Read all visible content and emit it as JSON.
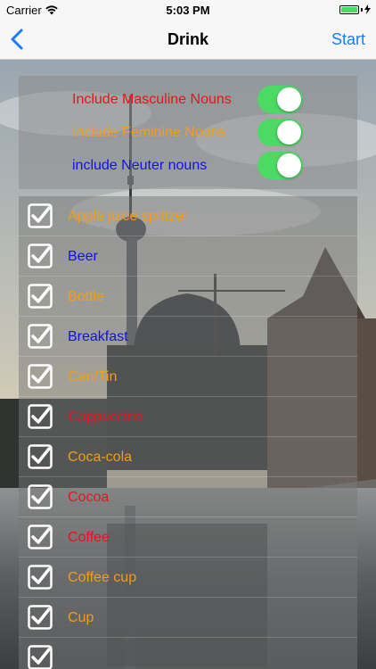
{
  "status_bar": {
    "carrier": "Carrier",
    "time": "5:03 PM",
    "battery_level": 1.0
  },
  "nav": {
    "back_icon": "chevron-left-icon",
    "title": "Drink",
    "start_label": "Start"
  },
  "toggles": [
    {
      "label": "Include Masculine Nouns",
      "color": "#e8131b",
      "on": true
    },
    {
      "label": "Include Feminine Nouns",
      "color": "#f39c1c",
      "on": true
    },
    {
      "label": "include Neuter nouns",
      "color": "#1111ee",
      "on": true
    }
  ],
  "nouns": [
    {
      "label": "Apple juice spritzer",
      "color": "#f39c1c",
      "checked": true
    },
    {
      "label": "Beer",
      "color": "#1111ee",
      "checked": true
    },
    {
      "label": "Bottle",
      "color": "#f39c1c",
      "checked": true
    },
    {
      "label": "Breakfast",
      "color": "#1111ee",
      "checked": true
    },
    {
      "label": "Can/Tin",
      "color": "#f39c1c",
      "checked": true
    },
    {
      "label": "Cappuccino",
      "color": "#e8131b",
      "checked": true
    },
    {
      "label": "Coca-cola",
      "color": "#f39c1c",
      "checked": true
    },
    {
      "label": "Cocoa",
      "color": "#e8131b",
      "checked": true
    },
    {
      "label": "Coffee",
      "color": "#e8131b",
      "checked": true
    },
    {
      "label": "Coffee cup",
      "color": "#f39c1c",
      "checked": true
    },
    {
      "label": "Cup",
      "color": "#f39c1c",
      "checked": true
    },
    {
      "label": "",
      "color": "#f39c1c",
      "checked": true
    }
  ],
  "colors": {
    "accent": "#1a7cf5",
    "switch_on": "#4cd964"
  }
}
